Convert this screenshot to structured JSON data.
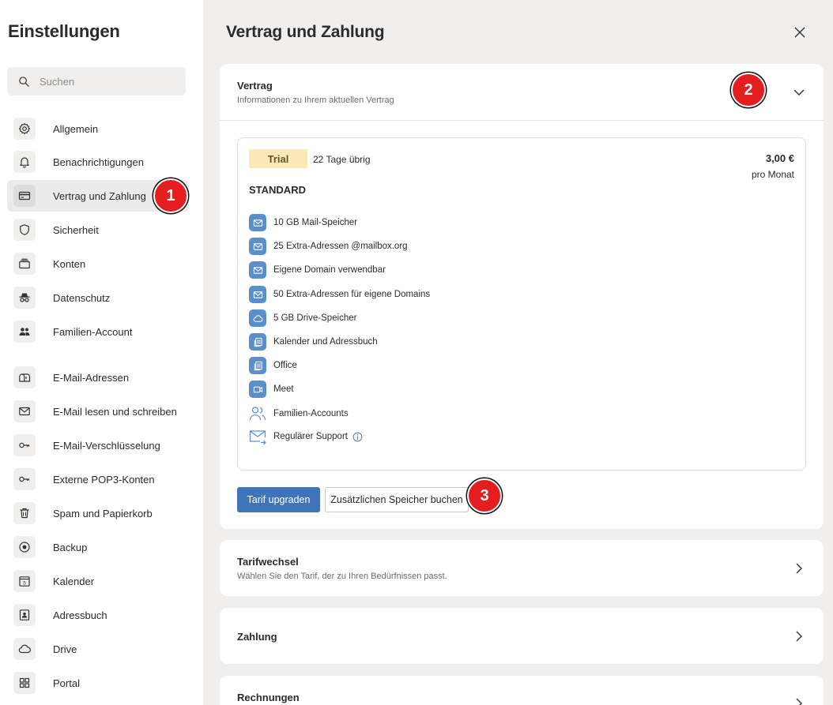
{
  "sidebar": {
    "title": "Einstellungen",
    "search_placeholder": "Suchen",
    "items": [
      {
        "label": "Allgemein",
        "icon": "gear-icon"
      },
      {
        "label": "Benachrichtigungen",
        "icon": "bell-icon"
      },
      {
        "label": "Vertrag und Zahlung",
        "icon": "credit-card-icon",
        "active": true
      },
      {
        "label": "Sicherheit",
        "icon": "shield-icon"
      },
      {
        "label": "Konten",
        "icon": "accounts-icon"
      },
      {
        "label": "Datenschutz",
        "icon": "incognito-icon"
      },
      {
        "label": "Familien-Account",
        "icon": "family-icon"
      },
      {
        "label": "E-Mail-Adressen",
        "icon": "mailbox-icon"
      },
      {
        "label": "E-Mail lesen und schreiben",
        "icon": "envelope-icon"
      },
      {
        "label": "E-Mail-Verschlüsselung",
        "icon": "key-icon"
      },
      {
        "label": "Externe POP3-Konten",
        "icon": "key-icon"
      },
      {
        "label": "Spam und Papierkorb",
        "icon": "trash-icon"
      },
      {
        "label": "Backup",
        "icon": "backup-icon"
      },
      {
        "label": "Kalender",
        "icon": "calendar-icon",
        "calendar_day": "5"
      },
      {
        "label": "Adressbuch",
        "icon": "addressbook-icon"
      },
      {
        "label": "Drive",
        "icon": "cloud-icon"
      },
      {
        "label": "Portal",
        "icon": "grid-icon"
      }
    ]
  },
  "main": {
    "title": "Vertrag und Zahlung",
    "contract": {
      "title": "Vertrag",
      "subtitle": "Informationen zu Ihrem aktuellen Vertrag",
      "badge": "Trial",
      "days_left": "22 Tage übrig",
      "price": "3,00 €",
      "period": "pro Monat",
      "plan": "STANDARD",
      "features": [
        {
          "label": "10 GB Mail-Speicher",
          "icon": "envelope-icon"
        },
        {
          "label": "25 Extra-Adressen @mailbox.org",
          "icon": "envelope-icon"
        },
        {
          "label": "Eigene Domain verwendbar",
          "icon": "envelope-icon"
        },
        {
          "label": "50 Extra-Adressen für eigene Domains",
          "icon": "envelope-icon"
        },
        {
          "label": "5 GB Drive-Speicher",
          "icon": "cloud-icon"
        },
        {
          "label": "Kalender und Adressbuch",
          "icon": "documents-icon"
        },
        {
          "label": "Office",
          "icon": "documents-icon"
        },
        {
          "label": "Meet",
          "icon": "video-icon"
        },
        {
          "label": "Familien-Accounts",
          "icon": "people-icon"
        },
        {
          "label": "Regulärer Support",
          "icon": "support-mail-icon"
        }
      ],
      "upgrade_button": "Tarif upgraden",
      "storage_button": "Zusätzlichen Speicher buchen"
    },
    "tariff_change": {
      "title": "Tarifwechsel",
      "subtitle": "Wählen Sie den Tarif, der zu Ihren Bedürfnissen passt."
    },
    "payment": {
      "title": "Zahlung"
    },
    "invoices": {
      "title": "Rechnungen"
    }
  },
  "markers": [
    "1",
    "2",
    "3"
  ],
  "colors": {
    "accent": "#3f74b8",
    "feature_icon": "#5c8ec9",
    "trial_badge": "#fce9b8",
    "marker": "#e41e1e",
    "background": "#f0efed"
  }
}
